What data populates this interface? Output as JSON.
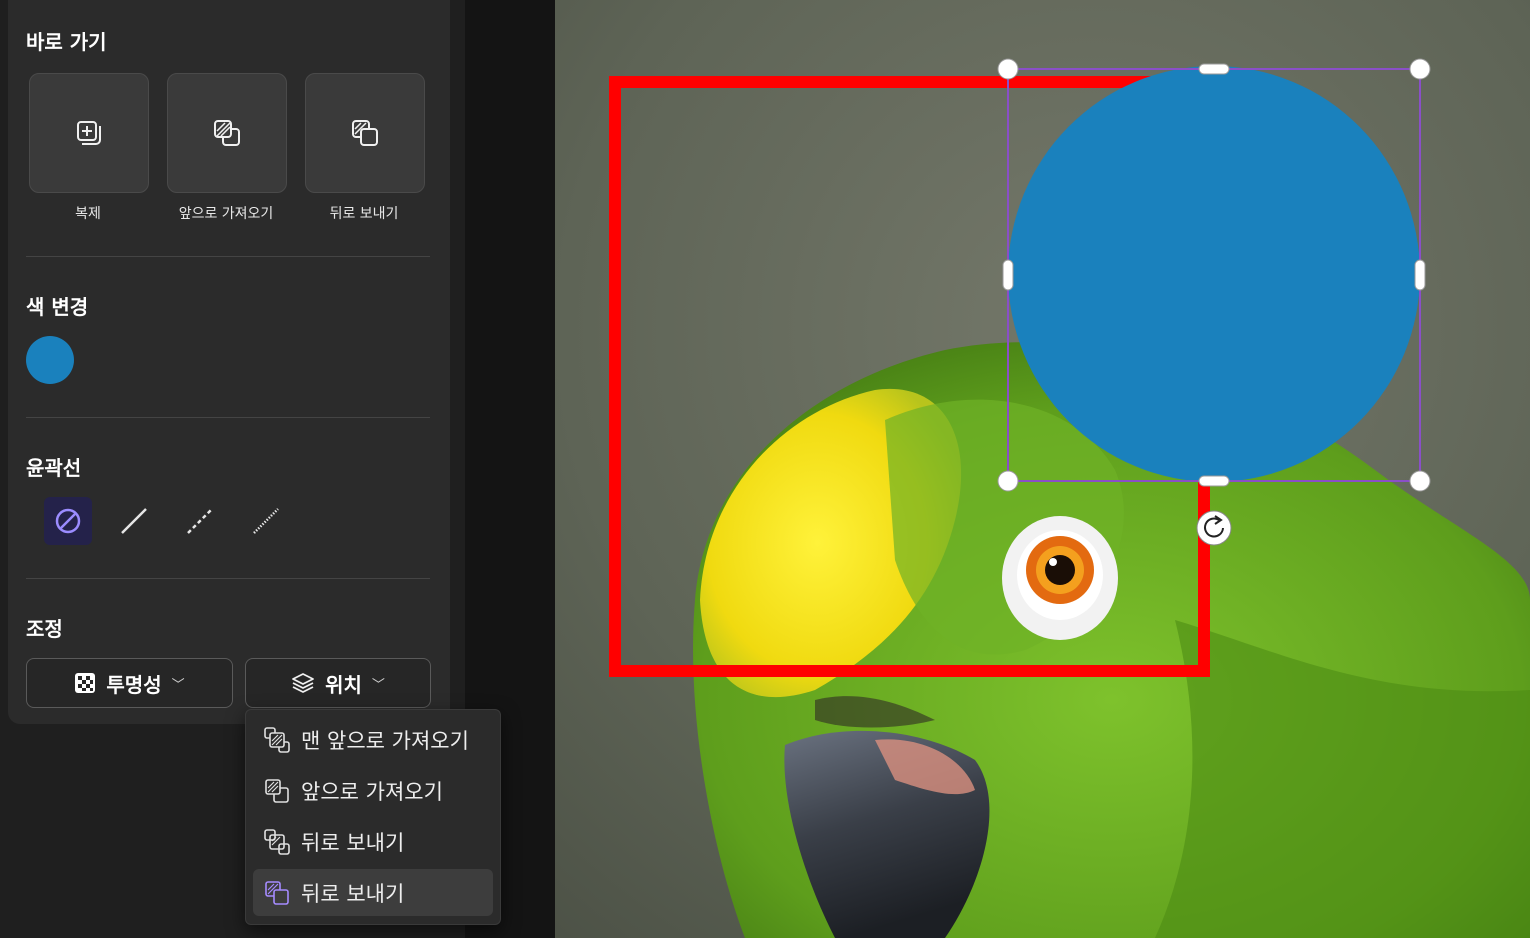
{
  "shortcuts": {
    "title": "바로 가기",
    "items": [
      {
        "label": "복제",
        "icon": "duplicate-icon"
      },
      {
        "label": "앞으로 가져오기",
        "icon": "bring-forward-icon"
      },
      {
        "label": "뒤로 보내기",
        "icon": "send-backward-icon"
      }
    ]
  },
  "color": {
    "title": "색 변경",
    "current": "#1a81bd"
  },
  "outline": {
    "title": "윤곽선",
    "options": [
      "none-icon",
      "solid-line-icon",
      "dashed-line-icon",
      "dotted-line-icon"
    ],
    "selected_index": 0
  },
  "adjust": {
    "title": "조정",
    "opacity_label": "투명성",
    "position_label": "위치"
  },
  "position_menu": {
    "items": [
      {
        "label": "맨 앞으로 가져오기",
        "icon": "bring-to-front-icon"
      },
      {
        "label": "앞으로 가져오기",
        "icon": "bring-forward-icon"
      },
      {
        "label": "뒤로 보내기",
        "icon": "send-backward-icon"
      },
      {
        "label": "뒤로 보내기",
        "icon": "send-to-back-icon"
      }
    ],
    "active_index": 3
  },
  "canvas": {
    "image": "green-parrot-photo",
    "rect_outline_color": "#ff0000",
    "circle_fill": "#1a81bd",
    "selection_color": "#8a4fc8",
    "rotate_icon": "rotate-icon"
  }
}
